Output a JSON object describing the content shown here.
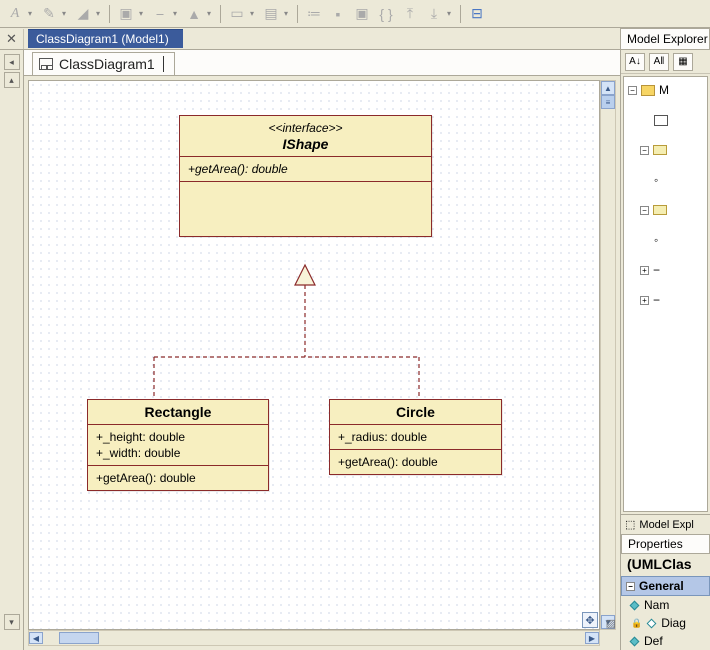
{
  "tab": {
    "title": "ClassDiagram1 (Model1)"
  },
  "modelExplorer": {
    "header": "Model Explorer"
  },
  "diagramTab": {
    "label": "ClassDiagram1"
  },
  "ishape": {
    "stereotype": "<<interface>>",
    "name": "IShape",
    "op": "+getArea(): double"
  },
  "rectangle": {
    "name": "Rectangle",
    "attr1": "+_height: double",
    "attr2": "+_width: double",
    "op": "+getArea(): double"
  },
  "circle": {
    "name": "Circle",
    "attr1": "+_radius: double",
    "op": "+getArea(): double"
  },
  "tree": {
    "root": "M"
  },
  "modelViewTab": {
    "label": "Model Expl"
  },
  "properties": {
    "header": "Properties",
    "title": "(UMLClas",
    "category": "General",
    "p1": "Nam",
    "p2": "Diag",
    "p3": "Def"
  }
}
